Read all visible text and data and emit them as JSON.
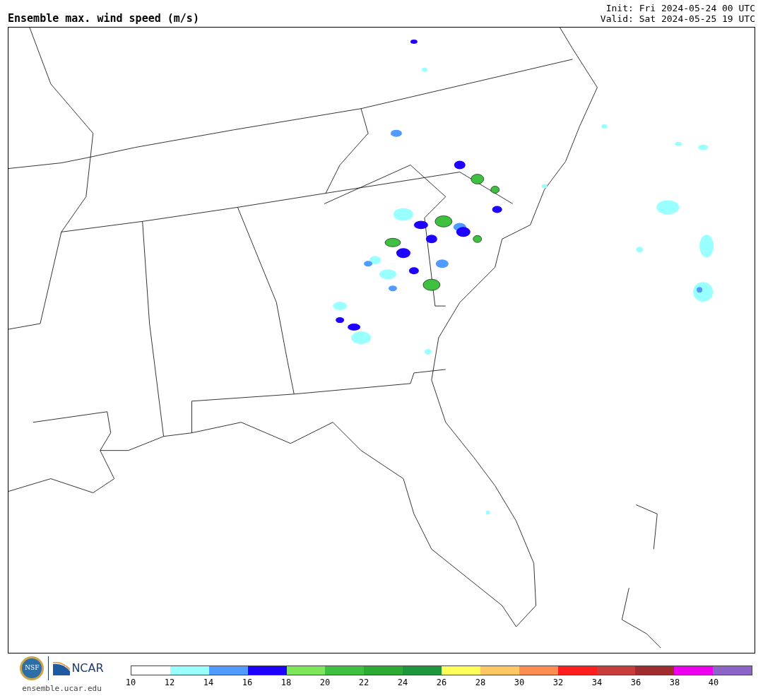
{
  "header": {
    "title": "Ensemble max. wind speed (m/s)",
    "init": "Init: Fri 2024-05-24 00 UTC",
    "valid": "Valid: Sat 2024-05-25 19 UTC"
  },
  "footer": {
    "nsf_logo": "NSF",
    "ncar_logo": "NCAR",
    "url": "ensemble.ucar.edu"
  },
  "colorbar": {
    "bins": [
      {
        "color": "#ffffff"
      },
      {
        "color": "#99ffff"
      },
      {
        "color": "#4f9bff"
      },
      {
        "color": "#1d00ff"
      },
      {
        "color": "#7de65a"
      },
      {
        "color": "#40c040"
      },
      {
        "color": "#2daa32"
      },
      {
        "color": "#1e963c"
      },
      {
        "color": "#ffff5a"
      },
      {
        "color": "#ffc864"
      },
      {
        "color": "#ff8c50"
      },
      {
        "color": "#ff1e1e"
      },
      {
        "color": "#c83c3c"
      },
      {
        "color": "#a02d2d"
      },
      {
        "color": "#ee00ee"
      },
      {
        "color": "#8c64c8"
      }
    ],
    "ticks": [
      "10",
      "12",
      "14",
      "16",
      "18",
      "20",
      "22",
      "24",
      "26",
      "28",
      "30",
      "32",
      "34",
      "36",
      "38",
      "40"
    ]
  }
}
